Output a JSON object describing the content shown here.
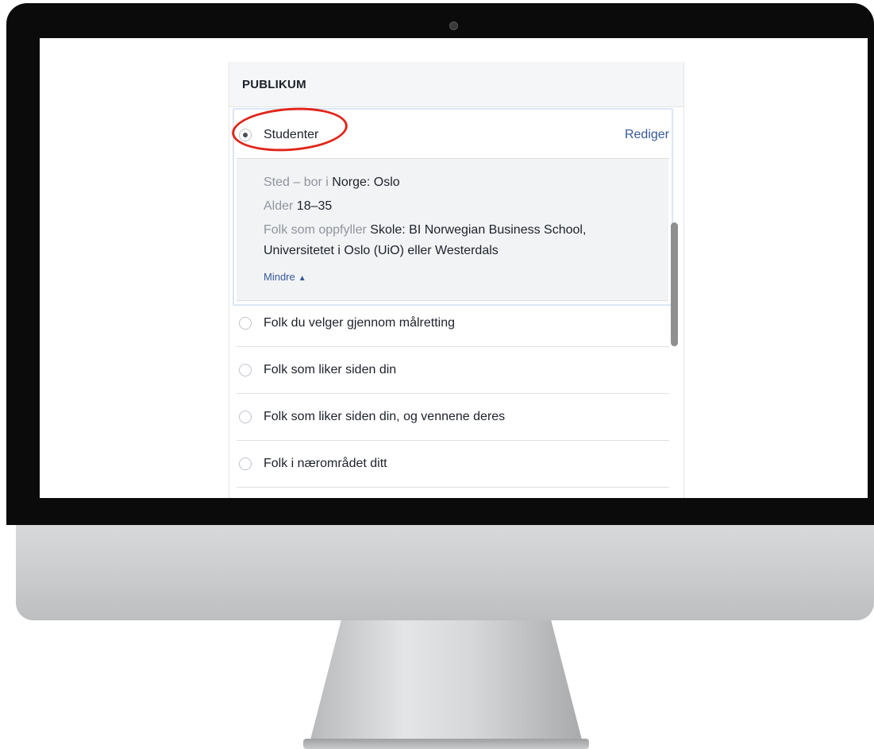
{
  "panel": {
    "title": "PUBLIKUM",
    "selected": {
      "label": "Studenter",
      "edit_label": "Rediger",
      "details": {
        "location_key": "Sted – bor i ",
        "location_value": "Norge: Oslo",
        "age_key": "Alder ",
        "age_value": "18–35",
        "criteria_key": "Folk som oppfyller ",
        "criteria_value_1": "Skole: BI Norwegian Business School,",
        "criteria_value_2": "Universitetet i Oslo (UiO) eller Westerdals",
        "less_label": "Mindre",
        "less_icon": "▲"
      }
    },
    "options": [
      {
        "label": "Folk du velger gjennom målretting"
      },
      {
        "label": "Folk som liker siden din"
      },
      {
        "label": "Folk som liker siden din, og vennene deres"
      },
      {
        "label": "Folk i nærområdet ditt"
      }
    ]
  },
  "colors": {
    "link": "#365899",
    "highlight_ring": "#e0261a",
    "details_bg": "#f2f3f5"
  }
}
